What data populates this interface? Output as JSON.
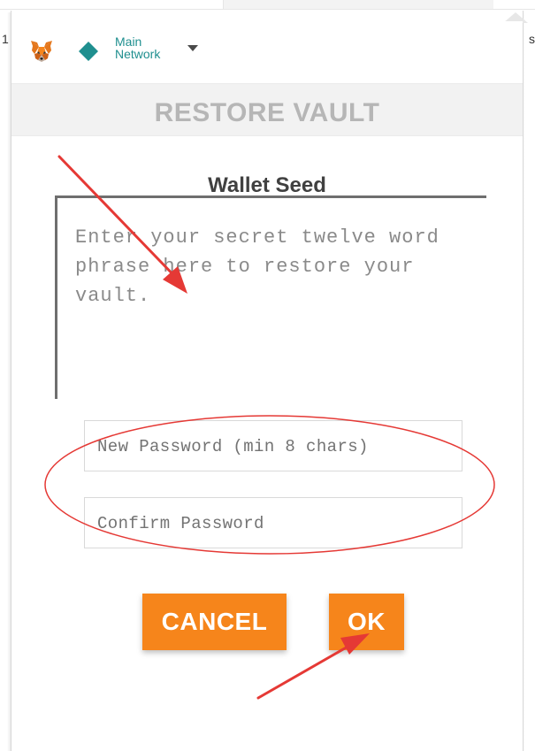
{
  "background": {
    "left_fragment": "1",
    "right_fragment": "s"
  },
  "header": {
    "logo_icon": "metamask-fox-icon",
    "network_icon": "network-diamond-icon",
    "network_line1": "Main",
    "network_line2": "Network",
    "caret_icon": "chevron-down-icon",
    "network_color": "#1f8f8f"
  },
  "page": {
    "title": "RESTORE VAULT"
  },
  "seed": {
    "label": "Wallet Seed",
    "placeholder": "Enter your secret twelve word phrase here to restore your vault."
  },
  "password": {
    "new_placeholder": "New Password (min 8 chars)",
    "confirm_placeholder": "Confirm Password"
  },
  "buttons": {
    "cancel_label": "CANCEL",
    "ok_label": "OK",
    "color": "#f6851b"
  },
  "annotation_color": "#e53935"
}
